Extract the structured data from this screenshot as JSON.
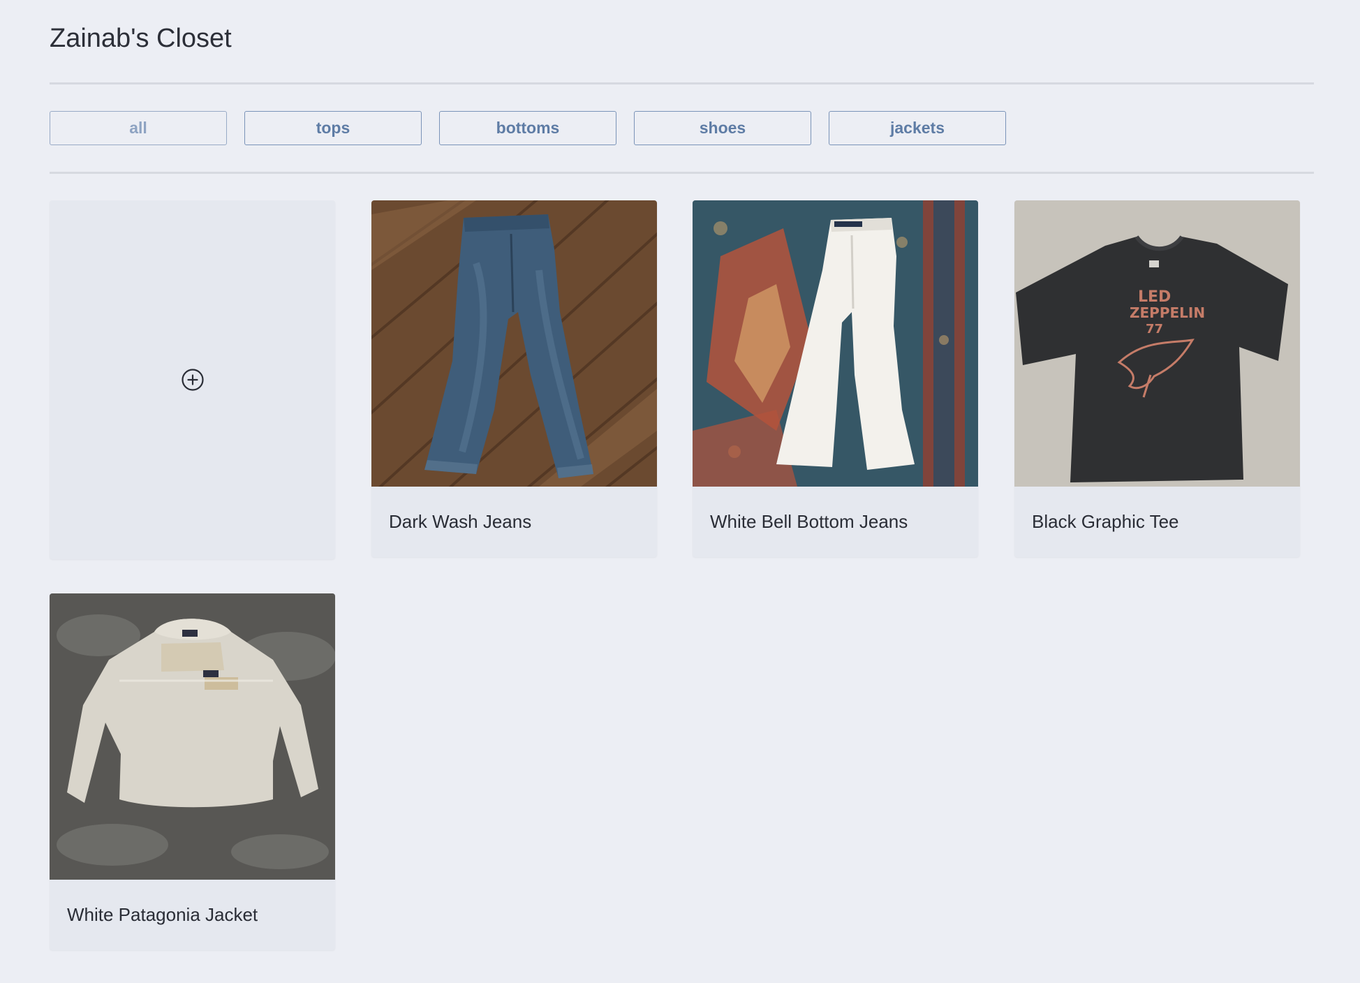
{
  "page": {
    "title": "Zainab's Closet"
  },
  "filters": [
    {
      "label": "all",
      "active": true
    },
    {
      "label": "tops",
      "active": false
    },
    {
      "label": "bottoms",
      "active": false
    },
    {
      "label": "shoes",
      "active": false
    },
    {
      "label": "jackets",
      "active": false
    }
  ],
  "add_card": {
    "icon": "plus-circle-icon"
  },
  "items": [
    {
      "name": "Dark Wash Jeans",
      "image": "dark-wash-jeans-photo"
    },
    {
      "name": "White Bell Bottom Jeans",
      "image": "white-bell-bottom-jeans-photo"
    },
    {
      "name": "Black Graphic Tee",
      "image": "black-graphic-tee-photo"
    },
    {
      "name": "White Patagonia Jacket",
      "image": "white-patagonia-jacket-photo"
    }
  ],
  "colors": {
    "background": "#eceef4",
    "card": "#e5e8ef",
    "button_border": "#7a93b8",
    "button_text": "#5e7ca5"
  }
}
